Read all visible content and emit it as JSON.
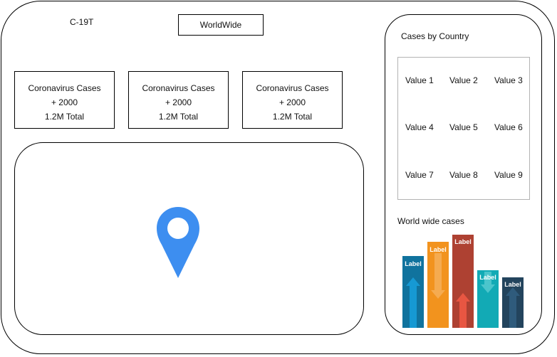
{
  "app": {
    "title": "C-19T"
  },
  "header": {
    "worldwide_button": "WorldWide"
  },
  "stats": [
    {
      "title": "Coronavirus Cases",
      "change": "+ 2000",
      "total": "1.2M Total"
    },
    {
      "title": "Coronavirus Cases",
      "change": "+ 2000",
      "total": "1.2M Total"
    },
    {
      "title": "Coronavirus Cases",
      "change": "+ 2000",
      "total": "1.2M Total"
    }
  ],
  "map": {
    "icon": "map-pin-icon",
    "color": "#3d8ef0"
  },
  "sidebar": {
    "title": "Cases by Country",
    "values": [
      "Value 1",
      "Value 2",
      "Value 3",
      "Value 4",
      "Value 5",
      "Value 6",
      "Value 7",
      "Value 8",
      "Value 9"
    ],
    "chart_title": "World wide cases",
    "chart_bars": [
      {
        "label": "Label",
        "color": "#10739e",
        "arrow_color": "#1699d3",
        "arrow": "up"
      },
      {
        "label": "Label",
        "color": "#f2931e",
        "arrow_color": "#f5ab50",
        "arrow": "down"
      },
      {
        "label": "Label",
        "color": "#ae4132",
        "arrow_color": "#e85642",
        "arrow": "up"
      },
      {
        "label": "Label",
        "color": "#12aab5",
        "arrow_color": "#4bc5cc",
        "arrow": "down"
      },
      {
        "label": "Label",
        "color": "#23445d",
        "arrow_color": "#2f5b7c",
        "arrow": "up"
      }
    ]
  }
}
